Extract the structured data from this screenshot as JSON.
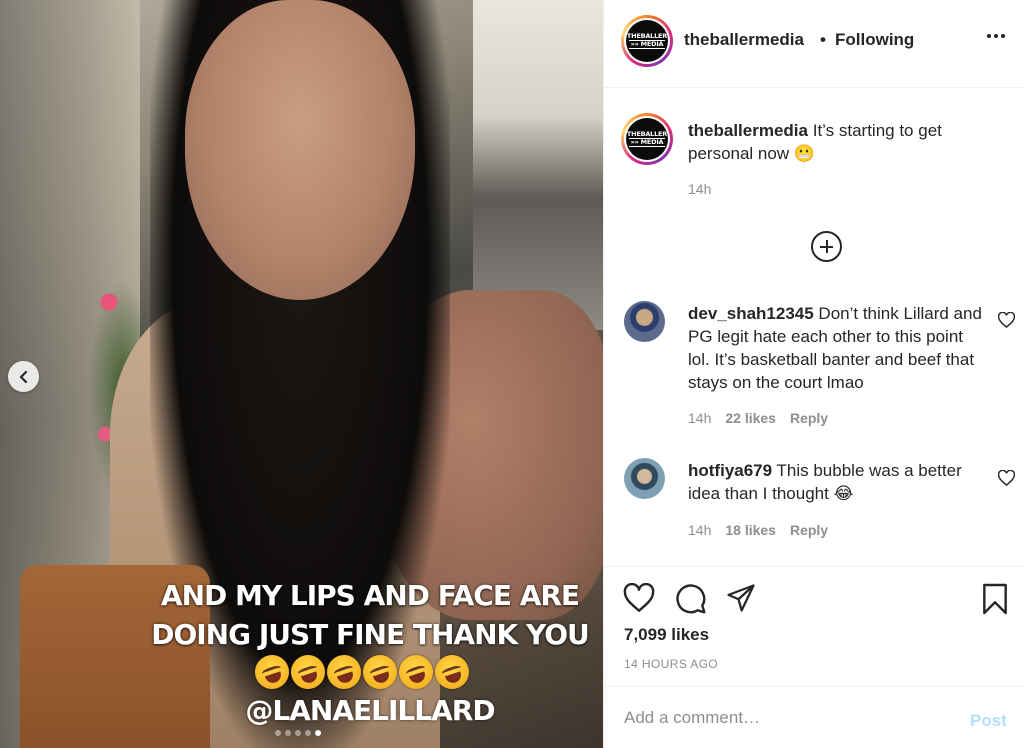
{
  "post": {
    "username": "theballermedia",
    "separator": "•",
    "follow_status": "Following",
    "avatar_logo": {
      "line1": "THEBALLER",
      "line2": "»» MEDIA",
      "line3": ""
    }
  },
  "media": {
    "caption_line1": "AND MY LIPS AND FACE ARE",
    "caption_line2": "DOING JUST FINE THANK YOU",
    "mention": "@LANAELILLARD",
    "emoji_count": 6,
    "carousel_slides": 5,
    "carousel_active": 4
  },
  "caption": {
    "username": "theballermedia",
    "text": " It’s starting to get personal now 😬",
    "time": "14h"
  },
  "comments": [
    {
      "username": "dev_shah12345",
      "text": " Don’t think Lillard and PG legit hate each other to this point lol. It’s basketball banter and beef that stays on the court lmao",
      "time": "14h",
      "likes": "22 likes",
      "reply": "Reply"
    },
    {
      "username": "hotfiya679",
      "text": " This bubble was a better idea than I thought 😂",
      "time": "14h",
      "likes": "18 likes",
      "reply": "Reply"
    }
  ],
  "stats": {
    "likes": "7,099 likes",
    "time_ago": "14 HOURS AGO"
  },
  "comment_box": {
    "placeholder": "Add a comment…",
    "post_label": "Post"
  },
  "icons": [
    "chevron-left-icon",
    "more-icon",
    "add-circle-icon",
    "heart-icon",
    "comment-icon",
    "share-icon",
    "bookmark-icon"
  ],
  "colors": {
    "post_disabled": "#b2dffc",
    "muted": "#8e8e8e",
    "text": "#262626"
  }
}
